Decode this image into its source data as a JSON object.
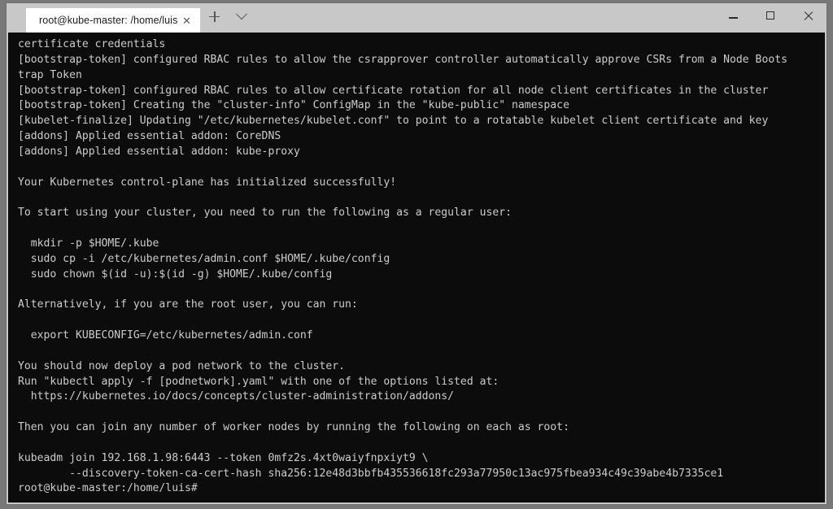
{
  "window": {
    "tab": {
      "title": "root@kube-master: /home/luis",
      "close_label": "✕"
    },
    "new_tab_label": "+",
    "tab_menu_label": "⌄",
    "controls": {
      "minimize_label": "–",
      "maximize_label": "□",
      "close_label": "✕"
    }
  },
  "terminal": {
    "background_color": "#0c0c0c",
    "foreground_color": "#cccccc",
    "prompt": "root@kube-master:/home/luis#",
    "lines": [
      "certificate credentials",
      "[bootstrap-token] configured RBAC rules to allow the csrapprover controller automatically approve CSRs from a Node Boots",
      "trap Token",
      "[bootstrap-token] configured RBAC rules to allow certificate rotation for all node client certificates in the cluster",
      "[bootstrap-token] Creating the \"cluster-info\" ConfigMap in the \"kube-public\" namespace",
      "[kubelet-finalize] Updating \"/etc/kubernetes/kubelet.conf\" to point to a rotatable kubelet client certificate and key",
      "[addons] Applied essential addon: CoreDNS",
      "[addons] Applied essential addon: kube-proxy",
      "",
      "Your Kubernetes control-plane has initialized successfully!",
      "",
      "To start using your cluster, you need to run the following as a regular user:",
      "",
      "  mkdir -p $HOME/.kube",
      "  sudo cp -i /etc/kubernetes/admin.conf $HOME/.kube/config",
      "  sudo chown $(id -u):$(id -g) $HOME/.kube/config",
      "",
      "Alternatively, if you are the root user, you can run:",
      "",
      "  export KUBECONFIG=/etc/kubernetes/admin.conf",
      "",
      "You should now deploy a pod network to the cluster.",
      "Run \"kubectl apply -f [podnetwork].yaml\" with one of the options listed at:",
      "  https://kubernetes.io/docs/concepts/cluster-administration/addons/",
      "",
      "Then you can join any number of worker nodes by running the following on each as root:",
      "",
      "kubeadm join 192.168.1.98:6443 --token 0mfz2s.4xt0waiyfnpxiyt9 \\",
      "        --discovery-token-ca-cert-hash sha256:12e48d3bbfb435536618fc293a77950c13ac975fbea934c49c39abe4b7335ce1",
      "root@kube-master:/home/luis#"
    ]
  }
}
